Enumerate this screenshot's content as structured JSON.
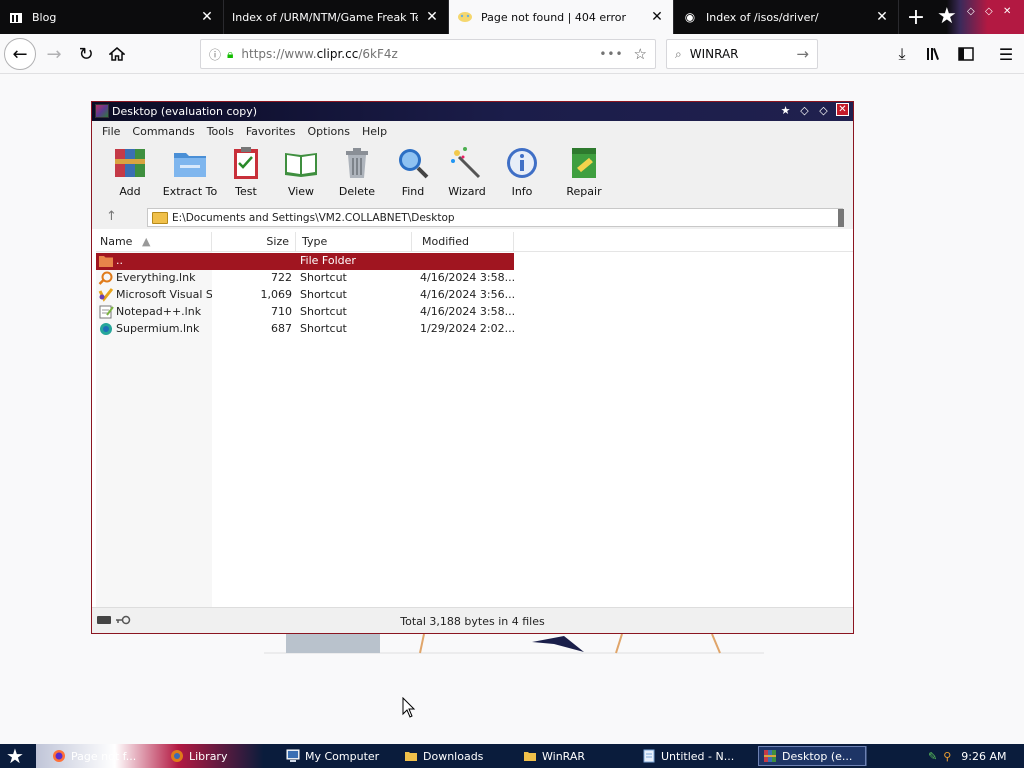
{
  "browser": {
    "tabs": [
      {
        "title": "Blog",
        "icon": "blog-favicon",
        "active": false
      },
      {
        "title": "Index of /URM/NTM/Game Freak Terak",
        "icon": "none",
        "active": false
      },
      {
        "title": "Page not found | 404 error",
        "icon": "clipr-favicon",
        "active": true
      },
      {
        "title": "Index of /isos/driver/",
        "icon": "globe-favicon",
        "active": false
      }
    ],
    "new_tab_label": "+",
    "url_prefix": "https://www.",
    "url_domain": "clipr.cc",
    "url_suffix": "/6kF4z",
    "url_more": "•••",
    "search_value": "WINRAR"
  },
  "winrar": {
    "title": "Desktop (evaluation copy)",
    "menu": [
      "File",
      "Commands",
      "Tools",
      "Favorites",
      "Options",
      "Help"
    ],
    "toolbar": [
      "Add",
      "Extract To",
      "Test",
      "View",
      "Delete",
      "Find",
      "Wizard",
      "Info",
      "Repair"
    ],
    "path": "E:\\Documents and Settings\\VM2.COLLABNET\\Desktop",
    "columns": {
      "name": "Name",
      "size": "Size",
      "type": "Type",
      "modified": "Modified"
    },
    "files": [
      {
        "name": "..",
        "size": "",
        "type": "File Folder",
        "modified": "",
        "icon": "folder-up-icon",
        "selected": true
      },
      {
        "name": "Everything.lnk",
        "size": "722",
        "type": "Shortcut",
        "modified": "4/16/2024 3:58...",
        "icon": "search-app-icon",
        "selected": false
      },
      {
        "name": "Microsoft Visual S...",
        "size": "1,069",
        "type": "Shortcut",
        "modified": "4/16/2024 3:56...",
        "icon": "visual-studio-icon",
        "selected": false
      },
      {
        "name": "Notepad++.lnk",
        "size": "710",
        "type": "Shortcut",
        "modified": "4/16/2024 3:58...",
        "icon": "notepad-icon",
        "selected": false
      },
      {
        "name": "Supermium.lnk",
        "size": "687",
        "type": "Shortcut",
        "modified": "1/29/2024 2:02...",
        "icon": "browser-icon",
        "selected": false
      }
    ],
    "status": "Total 3,188 bytes in 4 files"
  },
  "taskbar": {
    "tasks": [
      {
        "label": "Page not f...",
        "icon": "firefox-icon"
      },
      {
        "label": "Library",
        "icon": "library-icon"
      },
      {
        "label": "My Computer",
        "icon": "computer-icon"
      },
      {
        "label": "Downloads",
        "icon": "folder-icon"
      },
      {
        "label": "WinRAR",
        "icon": "folder-icon"
      },
      {
        "label": "Untitled - N...",
        "icon": "notepad-icon"
      },
      {
        "label": "Desktop (e...",
        "icon": "winrar-icon"
      }
    ],
    "clock": "9:26 AM"
  },
  "colors": {
    "selection": "#a01520",
    "title_bar": "#1b1d4a",
    "taskbar": "#0a1c3c"
  }
}
